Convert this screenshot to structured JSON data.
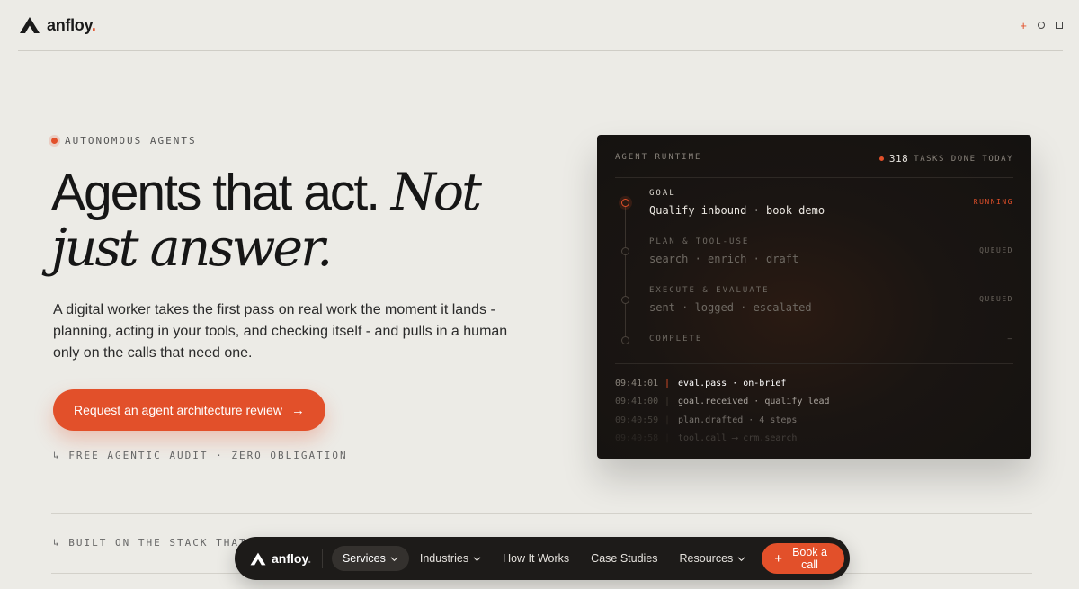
{
  "header": {
    "brand": "anfloy",
    "brand_dot": ".",
    "controls": [
      "plus-icon",
      "circle-icon",
      "square-icon"
    ]
  },
  "hero": {
    "eyebrow": "AUTONOMOUS AGENTS",
    "headline_sans": "Agents that act.",
    "headline_serif_1": "Not",
    "headline_serif_2": "just answer.",
    "lede": "A digital worker takes the first pass on real work the moment it lands - planning, acting in your tools, and checking itself - and pulls in a human only on the calls that need one.",
    "cta_label": "Request an agent architecture review",
    "cta_icon": "arrow-right-icon",
    "audit_note": "↳ FREE AGENTIC AUDIT · ZERO OBLIGATION"
  },
  "runtime": {
    "title": "AGENT RUNTIME",
    "tasks_count": "318",
    "tasks_label": "TASKS DONE TODAY",
    "steps": [
      {
        "label": "GOAL",
        "desc": "Qualify inbound · book demo",
        "status": "RUNNING"
      },
      {
        "label": "PLAN & TOOL-USE",
        "desc": "search · enrich · draft",
        "status": "QUEUED"
      },
      {
        "label": "EXECUTE & EVALUATE",
        "desc": "sent · logged · escalated",
        "status": "QUEUED"
      },
      {
        "label": "COMPLETE",
        "desc": "",
        "status": "—"
      }
    ],
    "log": [
      {
        "time": "09:41:01",
        "msg": "eval.pass · on-brief"
      },
      {
        "time": "09:41:00",
        "msg": "goal.received · qualify lead"
      },
      {
        "time": "09:40:59",
        "msg": "plan.drafted · 4 steps"
      },
      {
        "time": "09:40:58",
        "msg": "tool.call ⟶ crm.search"
      }
    ]
  },
  "built_on": "↳ BUILT ON THE STACK THAT S",
  "nav": {
    "brand": "anfloy",
    "brand_dot": ".",
    "items": [
      {
        "label": "Services",
        "dropdown": true,
        "selected": true
      },
      {
        "label": "Industries",
        "dropdown": true
      },
      {
        "label": "How It Works",
        "dropdown": false
      },
      {
        "label": "Case Studies",
        "dropdown": false
      },
      {
        "label": "Resources",
        "dropdown": true
      }
    ],
    "book_label": "Book a call"
  },
  "colors": {
    "accent": "#e2502a",
    "background": "#ecebe6",
    "panel": "#161311",
    "nav": "#1d1b19"
  }
}
